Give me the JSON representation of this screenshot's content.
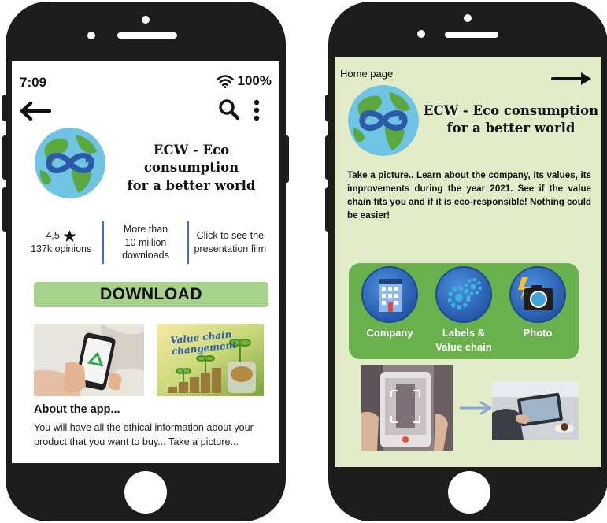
{
  "left_phone": {
    "status": {
      "time": "7:09",
      "battery": "100%"
    },
    "icons": {
      "back": "back-arrow-icon",
      "search": "search-icon",
      "menu": "more-vertical-icon",
      "wifi": "wifi-icon",
      "star": "star-icon"
    },
    "app": {
      "title_line1": "ECW - Eco consumption",
      "title_line2": "for a better world"
    },
    "stats": {
      "rating": "4,5",
      "opinions": "137k opinions",
      "downloads_line1": "More than",
      "downloads_line2": "10 million",
      "downloads_line3": "downloads",
      "film_line1": "Click to see the",
      "film_line2": "presentation film"
    },
    "download_label": "DOWNLOAD",
    "thumb2_line1": "Value chain",
    "thumb2_line2": "changement",
    "about": {
      "title": "About the app...",
      "text": "You will have all the ethical information about your product that you want to buy... Take a picture..."
    }
  },
  "right_phone": {
    "home_label": "Home page",
    "app": {
      "title_line1": "ECW - Eco consumption",
      "title_line2": "for a better world"
    },
    "description": "Take a picture.. Learn about the company, its values, its improvements during the year 2021. See if the value chain fits you and if it is eco-responsible! Nothing could be easier!",
    "features": [
      {
        "label_line1": "Company",
        "label_line2": "",
        "icon": "building-icon"
      },
      {
        "label_line1": "Labels &",
        "label_line2": "Value chain",
        "icon": "gears-icon"
      },
      {
        "label_line1": "Photo",
        "label_line2": "",
        "icon": "camera-icon"
      }
    ]
  },
  "colors": {
    "phone_frame": "#1c1c1c",
    "download_button": "#a9d18e",
    "right_screen_bg": "#e2ecc9",
    "feature_box": "#6ab04c",
    "feature_circle": "#2f6fc8",
    "separator": "#3f6fb5"
  }
}
